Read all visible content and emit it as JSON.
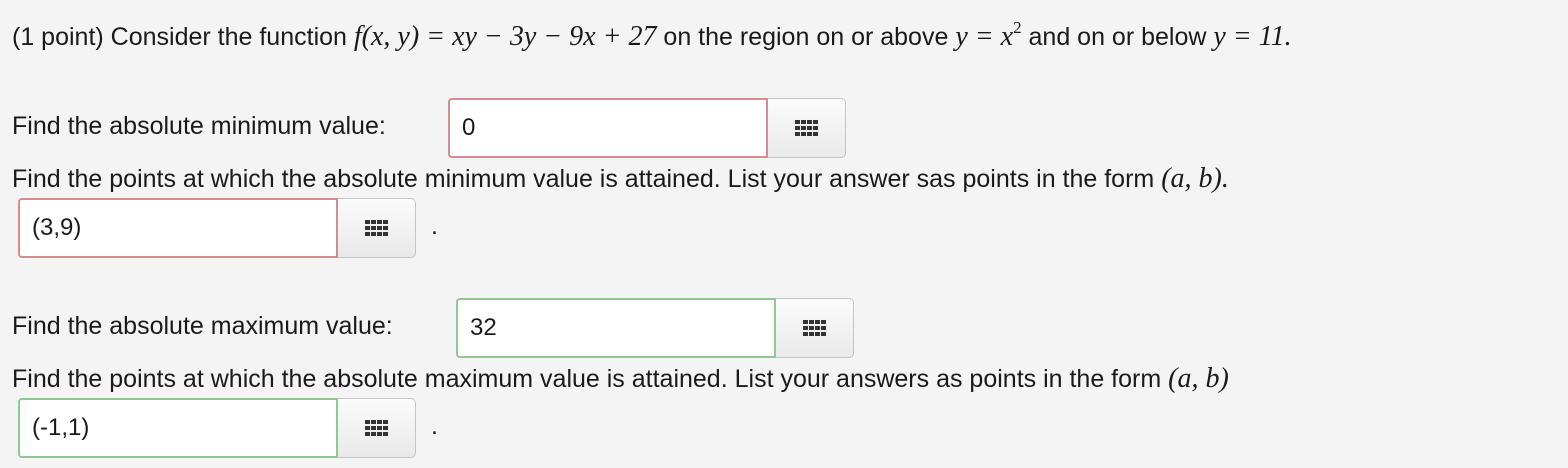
{
  "problem": {
    "points": "(1 point)",
    "intro": "Consider the function",
    "function": "f(x, y) = xy − 3y − 9x + 27",
    "region_prefix": "on the region on or above",
    "region_curve": "y = x",
    "region_curve_exponent": "2",
    "region_middle": "and on or below",
    "region_bound": "y = 11",
    "region_suffix": "."
  },
  "min_value": {
    "prompt": "Find the absolute minimum value:",
    "answer": "0",
    "status": "incorrect"
  },
  "min_points": {
    "prompt": "Find the points at which the absolute minimum value is attained. List your answer sas points in the form",
    "form": "(a, b)",
    "form_suffix": ".",
    "answer": "(3,9)",
    "status": "incorrect",
    "trailing": "."
  },
  "max_value": {
    "prompt": "Find the absolute maximum value:",
    "answer": "32",
    "status": "correct"
  },
  "max_points": {
    "prompt": "Find the points at which the absolute maximum value is attained. List your answers as points in the form",
    "form": "(a, b)",
    "answer": "(-1,1)",
    "status": "correct",
    "trailing": "."
  },
  "icons": {
    "palette_button": "grid-icon"
  },
  "colors": {
    "incorrect_border": "#d98a8a",
    "correct_border": "#8fc98f",
    "background": "#f4f4f4"
  }
}
